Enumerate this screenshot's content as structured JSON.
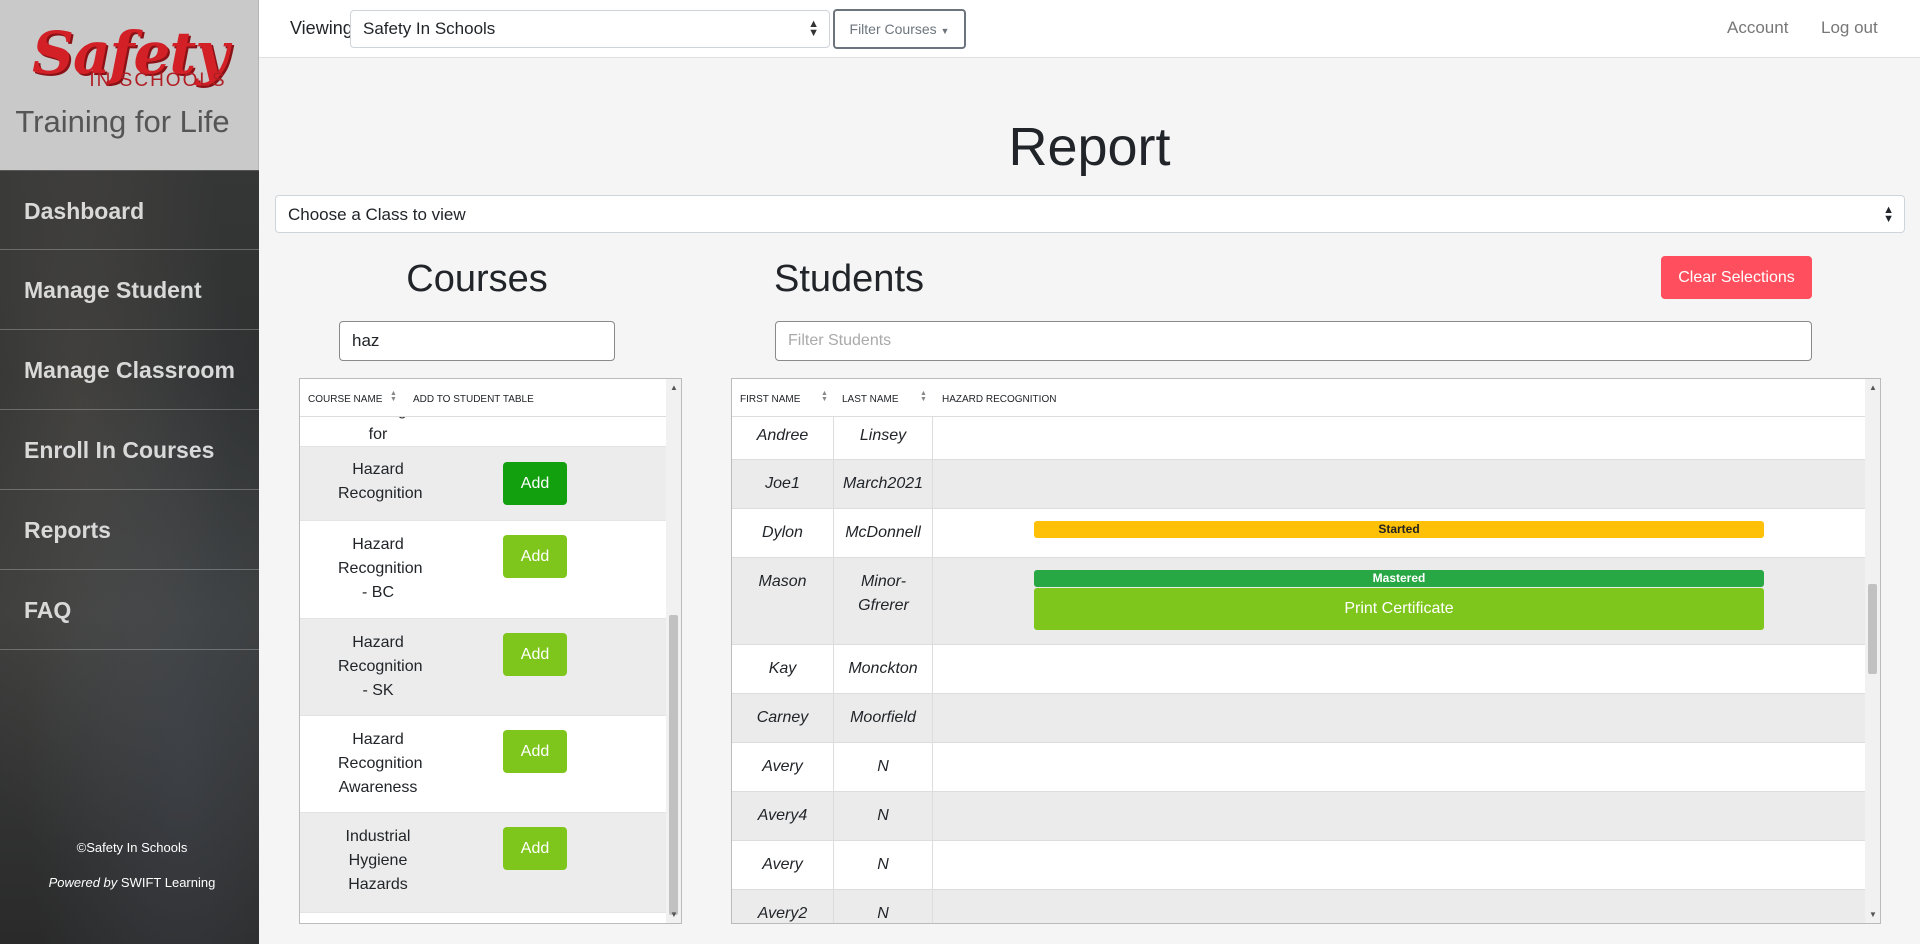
{
  "logo": {
    "brand": "Safety",
    "brand_sub": "IN SCHOOLS",
    "tagline": "Training for Life"
  },
  "nav": [
    {
      "label": "Dashboard"
    },
    {
      "label": "Manage Student"
    },
    {
      "label": "Manage Classroom"
    },
    {
      "label": "Enroll In Courses"
    },
    {
      "label": "Reports"
    },
    {
      "label": "FAQ"
    }
  ],
  "footer": {
    "copyright": "©Safety In Schools",
    "powered_by": "Powered by",
    "powered_name": "SWIFT Learning"
  },
  "topbar": {
    "viewing_label": "Viewing:",
    "viewing_value": "Safety In Schools",
    "filter_courses": "Filter Courses",
    "account": "Account",
    "logout": "Log out"
  },
  "page_title": "Report",
  "class_select": "Choose a Class to view",
  "courses": {
    "heading": "Courses",
    "filter_value": "haz",
    "col_course_name": "COURSE NAME",
    "col_add": "ADD TO STUDENT TABLE",
    "rows": [
      {
        "name": "Training for Managers",
        "add": ""
      },
      {
        "name": "Hazard Recognition",
        "add": "Add"
      },
      {
        "name": "Hazard Recognition - BC",
        "add": "Add"
      },
      {
        "name": "Hazard Recognition - SK",
        "add": "Add"
      },
      {
        "name": "Hazard Recognition Awareness",
        "add": "Add"
      },
      {
        "name": "Industrial Hygiene Hazards",
        "add": "Add"
      }
    ]
  },
  "students": {
    "heading": "Students",
    "clear_label": "Clear Selections",
    "filter_placeholder": "Filter Students",
    "col_first": "FIRST NAME",
    "col_last": "LAST NAME",
    "col_course": "HAZARD RECOGNITION",
    "rows": [
      {
        "first": "Andree",
        "last": "Linsey",
        "status": ""
      },
      {
        "first": "Joe1",
        "last": "March2021",
        "status": ""
      },
      {
        "first": "Dylon",
        "last": "McDonnell",
        "status": "Started"
      },
      {
        "first": "Mason",
        "last": "Minor-Gfrerer",
        "status": "Mastered",
        "action": "Print Certificate"
      },
      {
        "first": "Kay",
        "last": "Monckton",
        "status": ""
      },
      {
        "first": "Carney",
        "last": "Moorfield",
        "status": ""
      },
      {
        "first": "Avery",
        "last": "N",
        "status": ""
      },
      {
        "first": "Avery4",
        "last": "N",
        "status": ""
      },
      {
        "first": "Avery",
        "last": "N",
        "status": ""
      },
      {
        "first": "Avery2",
        "last": "N",
        "status": ""
      }
    ]
  },
  "colors": {
    "add_button": "#7ec61b",
    "add_button_active": "#12a00f",
    "started": "#ffc107",
    "mastered": "#28a745",
    "clear_button": "#ff4f5e"
  }
}
